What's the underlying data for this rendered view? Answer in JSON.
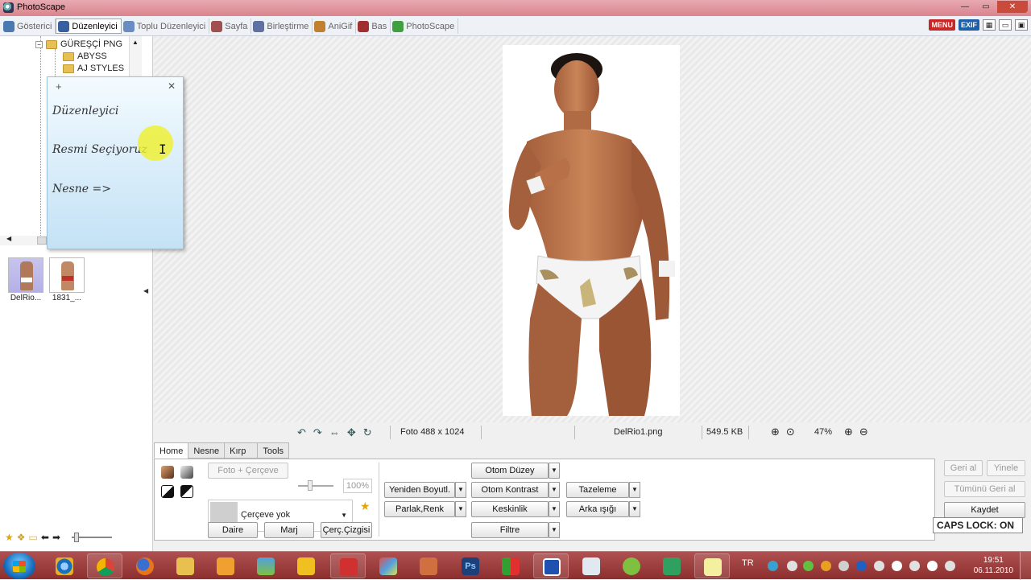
{
  "window": {
    "title": "PhotoScape",
    "min": "—",
    "max": "▭",
    "close": "✕"
  },
  "tabs": [
    {
      "label": "Gösterici",
      "color": "#4a7ab0"
    },
    {
      "label": "Düzenleyici",
      "color": "#3a5fa0",
      "active": true
    },
    {
      "label": "Toplu Düzenleyici",
      "color": "#6a8cc0"
    },
    {
      "label": "Sayfa",
      "color": "#a05050"
    },
    {
      "label": "Birleştirme",
      "color": "#6070a0"
    },
    {
      "label": "AniGif",
      "color": "#c08030"
    },
    {
      "label": "Bas",
      "color": "#a03030"
    },
    {
      "label": "PhotoScape",
      "color": "#40a040"
    }
  ],
  "topright": {
    "menu": "MENU",
    "exif": "EXIF"
  },
  "tree": {
    "root": "GÜREŞÇİ PNG",
    "items": [
      "ABYSS",
      "AJ STYLES"
    ]
  },
  "note": {
    "lines": [
      "Düzenleyici",
      "Resmi Seçiyoruz",
      "Nesne =>"
    ],
    "add": "+",
    "close": "✕"
  },
  "thumbnails": [
    {
      "label": "DelRio...",
      "selected": true
    },
    {
      "label": "1831_..."
    }
  ],
  "status": {
    "photo_size": "Foto 488 x 1024",
    "filename": "DelRio1.png",
    "filesize": "549.5 KB",
    "zoom": "47%"
  },
  "editor": {
    "tabs": [
      "Home",
      "Nesne",
      "Kırp",
      "Tools"
    ],
    "frame_button": "Foto + Çerçeve",
    "opacity": "100%",
    "frame_select": "Çerçeve yok",
    "daire": "Daire",
    "marj": "Marj",
    "cerc_cizgisi": "Çerç.Çizgisi",
    "otom_duzey": "Otom Düzey",
    "yeniden_boyutl": "Yeniden Boyutl.",
    "otom_kontrast": "Otom Kontrast",
    "tazeleme": "Tazeleme",
    "parlak_renk": "Parlak,Renk",
    "keskinlik": "Keskinlik",
    "arka_isigi": "Arka ışığı",
    "filtre": "Filtre",
    "geri_al": "Geri al",
    "yinele": "Yinele",
    "tumunu_geri_al": "Tümünü Geri al",
    "kaydet": "Kaydet"
  },
  "capslock": "CAPS LOCK: ON",
  "taskbar": {
    "lang": "TR",
    "time": "19:51",
    "date": "06.11.2010"
  }
}
